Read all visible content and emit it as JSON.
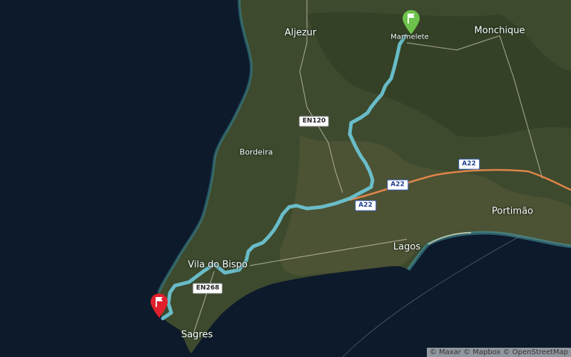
{
  "map": {
    "imagery": "satellite",
    "colors": {
      "ocean": "#0d1a2b",
      "land": "#3d4a2e",
      "route": "#6ec9d9",
      "motorway": "#e0864a",
      "start_marker": "#6dc24b",
      "end_marker": "#e0202c"
    }
  },
  "places": {
    "aljezur": "Aljezur",
    "marmelete": "Marmelete",
    "monchique": "Monchique",
    "bordeira": "Bordeira",
    "vila_do_bispo": "Vila do Bispo",
    "lagos": "Lagos",
    "portimao": "Portimão",
    "sagres": "Sagres"
  },
  "roads": {
    "en120": "EN120",
    "en268": "EN268",
    "a22_east": "A22",
    "a22_mid": "A22",
    "a22_west": "A22"
  },
  "markers": {
    "start_icon": "flag-icon",
    "end_icon": "flag-icon"
  },
  "attribution": "© Maxar © Mapbox © OpenStreetMap"
}
